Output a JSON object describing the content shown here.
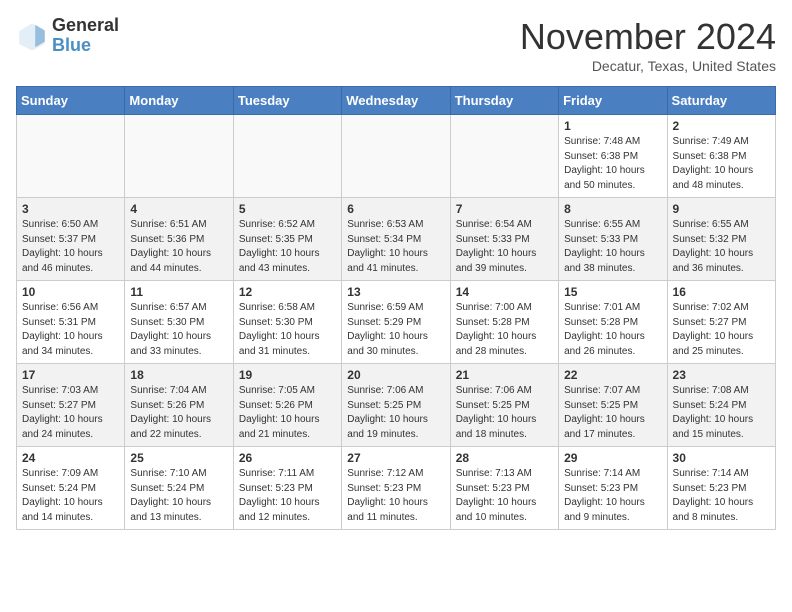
{
  "header": {
    "logo_general": "General",
    "logo_blue": "Blue",
    "month_title": "November 2024",
    "location": "Decatur, Texas, United States"
  },
  "weekdays": [
    "Sunday",
    "Monday",
    "Tuesday",
    "Wednesday",
    "Thursday",
    "Friday",
    "Saturday"
  ],
  "weeks": [
    [
      {
        "day": "",
        "info": ""
      },
      {
        "day": "",
        "info": ""
      },
      {
        "day": "",
        "info": ""
      },
      {
        "day": "",
        "info": ""
      },
      {
        "day": "",
        "info": ""
      },
      {
        "day": "1",
        "info": "Sunrise: 7:48 AM\nSunset: 6:38 PM\nDaylight: 10 hours\nand 50 minutes."
      },
      {
        "day": "2",
        "info": "Sunrise: 7:49 AM\nSunset: 6:38 PM\nDaylight: 10 hours\nand 48 minutes."
      }
    ],
    [
      {
        "day": "3",
        "info": "Sunrise: 6:50 AM\nSunset: 5:37 PM\nDaylight: 10 hours\nand 46 minutes."
      },
      {
        "day": "4",
        "info": "Sunrise: 6:51 AM\nSunset: 5:36 PM\nDaylight: 10 hours\nand 44 minutes."
      },
      {
        "day": "5",
        "info": "Sunrise: 6:52 AM\nSunset: 5:35 PM\nDaylight: 10 hours\nand 43 minutes."
      },
      {
        "day": "6",
        "info": "Sunrise: 6:53 AM\nSunset: 5:34 PM\nDaylight: 10 hours\nand 41 minutes."
      },
      {
        "day": "7",
        "info": "Sunrise: 6:54 AM\nSunset: 5:33 PM\nDaylight: 10 hours\nand 39 minutes."
      },
      {
        "day": "8",
        "info": "Sunrise: 6:55 AM\nSunset: 5:33 PM\nDaylight: 10 hours\nand 38 minutes."
      },
      {
        "day": "9",
        "info": "Sunrise: 6:55 AM\nSunset: 5:32 PM\nDaylight: 10 hours\nand 36 minutes."
      }
    ],
    [
      {
        "day": "10",
        "info": "Sunrise: 6:56 AM\nSunset: 5:31 PM\nDaylight: 10 hours\nand 34 minutes."
      },
      {
        "day": "11",
        "info": "Sunrise: 6:57 AM\nSunset: 5:30 PM\nDaylight: 10 hours\nand 33 minutes."
      },
      {
        "day": "12",
        "info": "Sunrise: 6:58 AM\nSunset: 5:30 PM\nDaylight: 10 hours\nand 31 minutes."
      },
      {
        "day": "13",
        "info": "Sunrise: 6:59 AM\nSunset: 5:29 PM\nDaylight: 10 hours\nand 30 minutes."
      },
      {
        "day": "14",
        "info": "Sunrise: 7:00 AM\nSunset: 5:28 PM\nDaylight: 10 hours\nand 28 minutes."
      },
      {
        "day": "15",
        "info": "Sunrise: 7:01 AM\nSunset: 5:28 PM\nDaylight: 10 hours\nand 26 minutes."
      },
      {
        "day": "16",
        "info": "Sunrise: 7:02 AM\nSunset: 5:27 PM\nDaylight: 10 hours\nand 25 minutes."
      }
    ],
    [
      {
        "day": "17",
        "info": "Sunrise: 7:03 AM\nSunset: 5:27 PM\nDaylight: 10 hours\nand 24 minutes."
      },
      {
        "day": "18",
        "info": "Sunrise: 7:04 AM\nSunset: 5:26 PM\nDaylight: 10 hours\nand 22 minutes."
      },
      {
        "day": "19",
        "info": "Sunrise: 7:05 AM\nSunset: 5:26 PM\nDaylight: 10 hours\nand 21 minutes."
      },
      {
        "day": "20",
        "info": "Sunrise: 7:06 AM\nSunset: 5:25 PM\nDaylight: 10 hours\nand 19 minutes."
      },
      {
        "day": "21",
        "info": "Sunrise: 7:06 AM\nSunset: 5:25 PM\nDaylight: 10 hours\nand 18 minutes."
      },
      {
        "day": "22",
        "info": "Sunrise: 7:07 AM\nSunset: 5:25 PM\nDaylight: 10 hours\nand 17 minutes."
      },
      {
        "day": "23",
        "info": "Sunrise: 7:08 AM\nSunset: 5:24 PM\nDaylight: 10 hours\nand 15 minutes."
      }
    ],
    [
      {
        "day": "24",
        "info": "Sunrise: 7:09 AM\nSunset: 5:24 PM\nDaylight: 10 hours\nand 14 minutes."
      },
      {
        "day": "25",
        "info": "Sunrise: 7:10 AM\nSunset: 5:24 PM\nDaylight: 10 hours\nand 13 minutes."
      },
      {
        "day": "26",
        "info": "Sunrise: 7:11 AM\nSunset: 5:23 PM\nDaylight: 10 hours\nand 12 minutes."
      },
      {
        "day": "27",
        "info": "Sunrise: 7:12 AM\nSunset: 5:23 PM\nDaylight: 10 hours\nand 11 minutes."
      },
      {
        "day": "28",
        "info": "Sunrise: 7:13 AM\nSunset: 5:23 PM\nDaylight: 10 hours\nand 10 minutes."
      },
      {
        "day": "29",
        "info": "Sunrise: 7:14 AM\nSunset: 5:23 PM\nDaylight: 10 hours\nand 9 minutes."
      },
      {
        "day": "30",
        "info": "Sunrise: 7:14 AM\nSunset: 5:23 PM\nDaylight: 10 hours\nand 8 minutes."
      }
    ]
  ]
}
